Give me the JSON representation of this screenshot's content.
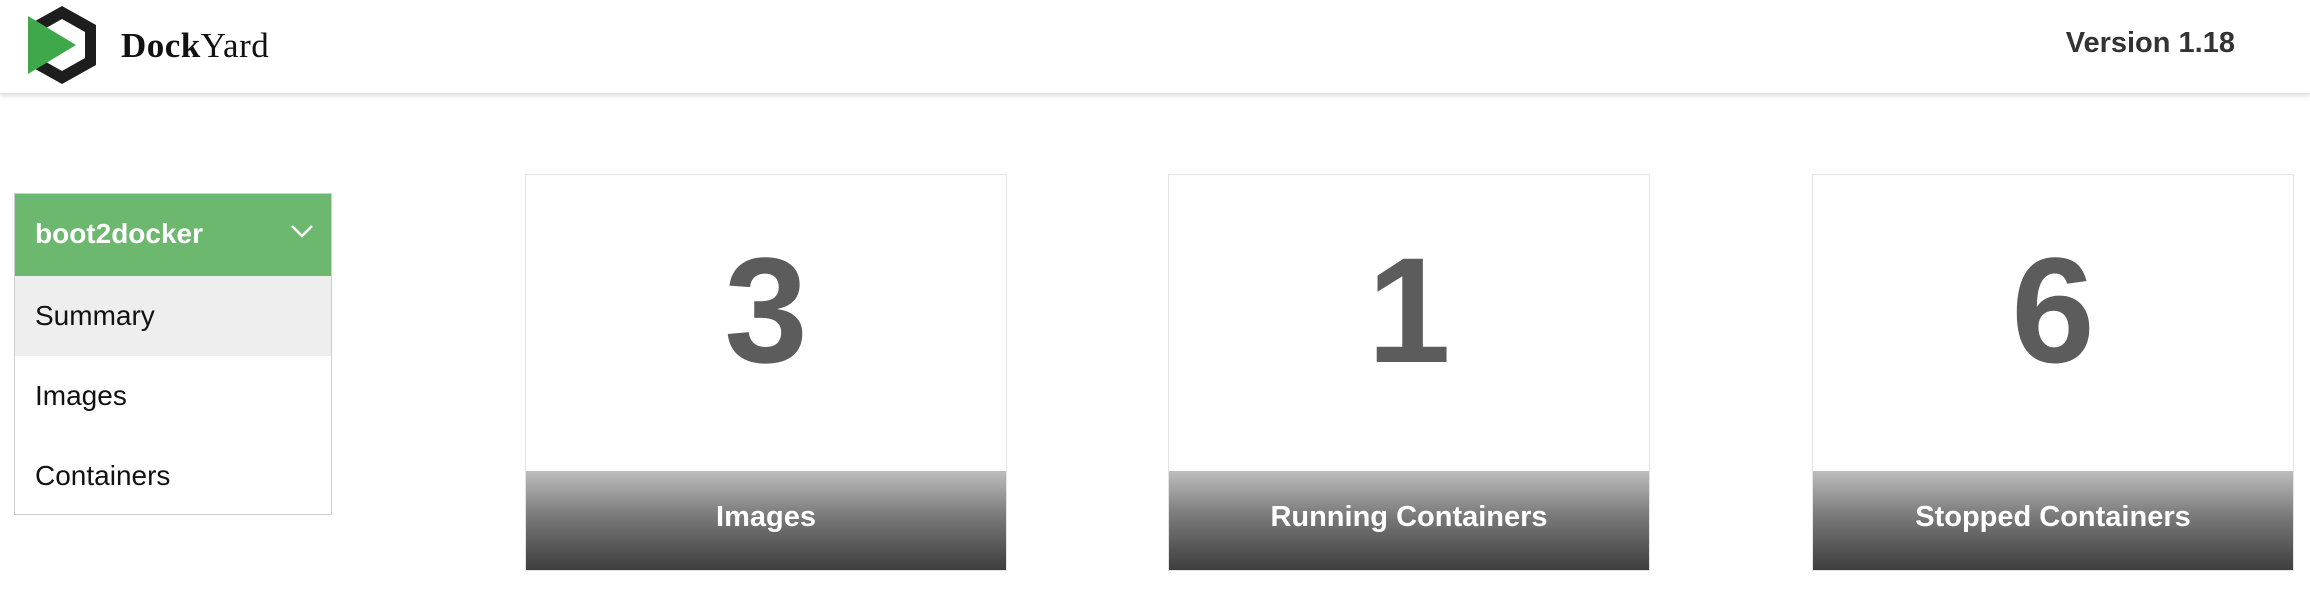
{
  "header": {
    "brand_part1": "Dock",
    "brand_part2": "Yard",
    "version_text": "Version 1.18",
    "logo_icon": "dockyard-logo-icon"
  },
  "sidebar": {
    "host_name": "boot2docker",
    "dropdown_icon": "chevron-down-icon",
    "items": [
      {
        "label": "Summary",
        "active": true
      },
      {
        "label": "Images",
        "active": false
      },
      {
        "label": "Containers",
        "active": false
      }
    ]
  },
  "stats": [
    {
      "value": "3",
      "label": "Images"
    },
    {
      "value": "1",
      "label": "Running Containers"
    },
    {
      "value": "6",
      "label": "Stopped Containers"
    }
  ],
  "colors": {
    "accent_green": "#6db86f",
    "logo_green": "#3fa84a",
    "value_gray": "#5c5c5c",
    "active_item_bg": "#eeeeee"
  }
}
